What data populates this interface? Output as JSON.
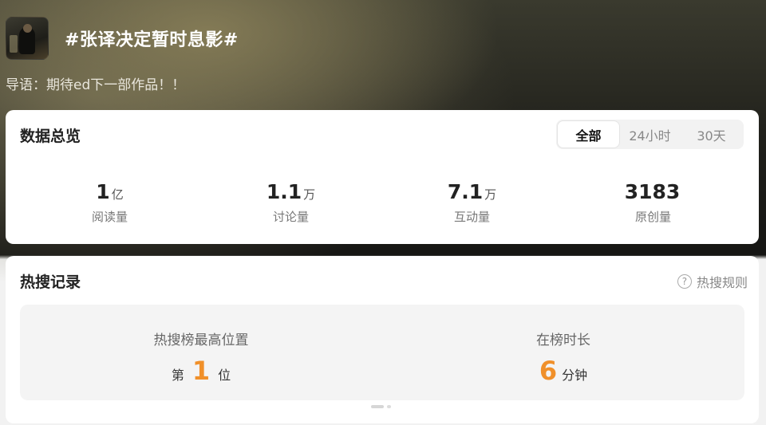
{
  "topic": {
    "title": "#张译决定暂时息影#",
    "guide": "导语：期待ed下一部作品！！"
  },
  "overview": {
    "title": "数据总览",
    "tabs": [
      {
        "label": "全部",
        "active": true
      },
      {
        "label": "24小时",
        "active": false
      },
      {
        "label": "30天",
        "active": false
      }
    ],
    "stats": [
      {
        "value": "1",
        "unit": "亿",
        "label": "阅读量"
      },
      {
        "value": "1.1",
        "unit": "万",
        "label": "讨论量"
      },
      {
        "value": "7.1",
        "unit": "万",
        "label": "互动量"
      },
      {
        "value": "3183",
        "unit": "",
        "label": "原创量"
      }
    ]
  },
  "hot": {
    "title": "热搜记录",
    "rules_label": "热搜规则",
    "help_glyph": "?",
    "best_rank": {
      "label": "热搜榜最高位置",
      "prefix": "第",
      "value": "1",
      "suffix": "位"
    },
    "duration": {
      "label": "在榜时长",
      "value": "6",
      "suffix": "分钟"
    }
  },
  "colors": {
    "accent": "#f0902a"
  }
}
